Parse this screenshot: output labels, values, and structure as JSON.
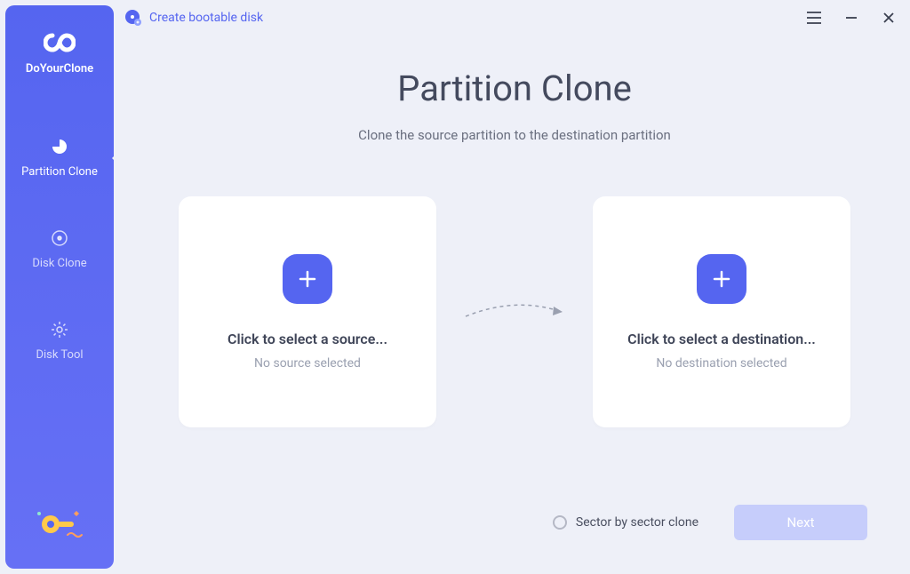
{
  "app_name": "DoYourClone",
  "topbar": {
    "bootable_link": "Create bootable disk"
  },
  "sidebar": {
    "items": [
      {
        "label": "Partition Clone",
        "icon": "pie-chart-icon",
        "active": true
      },
      {
        "label": "Disk Clone",
        "icon": "disk-scan-icon",
        "active": false
      },
      {
        "label": "Disk Tool",
        "icon": "gear-icon",
        "active": false
      }
    ]
  },
  "main": {
    "title": "Partition Clone",
    "subtitle": "Clone the source partition to the destination partition",
    "source_card": {
      "title": "Click to select a source...",
      "subtitle": "No source selected"
    },
    "dest_card": {
      "title": "Click to select a destination...",
      "subtitle": "No destination selected"
    }
  },
  "footer": {
    "sector_option": "Sector by sector clone",
    "next_label": "Next"
  },
  "colors": {
    "accent": "#5565f0",
    "bg": "#eef0f8",
    "card": "#ffffff",
    "text": "#444a5e",
    "muted": "#9aa0b0",
    "next_disabled": "#c6cdfb"
  }
}
